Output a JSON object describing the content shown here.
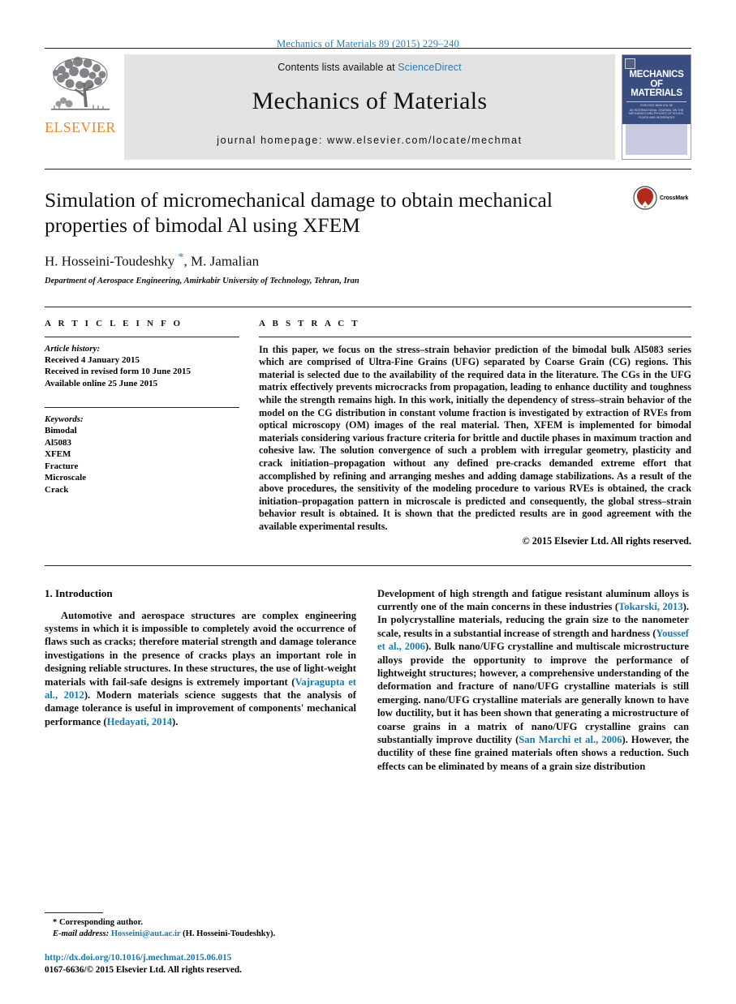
{
  "running_head": "Mechanics of Materials 89 (2015) 229–240",
  "masthead": {
    "publisher_logo_word": "ELSEVIER",
    "contents_prefix": "Contents lists available at ",
    "contents_link": "ScienceDirect",
    "journal_name": "Mechanics of Materials",
    "homepage": "journal homepage: www.elsevier.com/locate/mechmat",
    "cover": {
      "line1": "MECHANICS",
      "line2": "OF",
      "line3": "MATERIALS",
      "issn_line": "ISSN 0167-6636   VOL 89",
      "blurb": "AN INTERNATIONAL JOURNAL ON THE MECHANICS AND PHYSICS OF SOLIDS, FLUIDS AND INTERFACES"
    }
  },
  "article": {
    "title": "Simulation of micromechanical damage to obtain mechanical properties of bimodal Al using XFEM",
    "authors_part1": "H. Hosseini-Toudeshky ",
    "authors_star": "*",
    "authors_part2": ", M. Jamalian",
    "affiliation": "Department of Aerospace Engineering, Amirkabir University of Technology, Tehran, Iran",
    "crossmark_label": "CrossMark"
  },
  "article_info": {
    "heading": "A R T I C L E  I N F O",
    "history_label": "Article history:",
    "history": [
      "Received 4 January 2015",
      "Received in revised form 10 June 2015",
      "Available online 25 June 2015"
    ],
    "keywords_label": "Keywords:",
    "keywords": [
      "Bimodal",
      "Al5083",
      "XFEM",
      "Fracture",
      "Microscale",
      "Crack"
    ]
  },
  "abstract": {
    "heading": "A B S T R A C T",
    "text": "In this paper, we focus on the stress–strain behavior prediction of the bimodal bulk Al5083 series which are comprised of Ultra-Fine Grains (UFG) separated by Coarse Grain (CG) regions. This material is selected due to the availability of the required data in the literature. The CGs in the UFG matrix effectively prevents microcracks from propagation, leading to enhance ductility and toughness while the strength remains high. In this work, initially the dependency of stress–strain behavior of the model on the CG distribution in constant volume fraction is investigated by extraction of RVEs from optical microscopy (OM) images of the real material. Then, XFEM is implemented for bimodal materials considering various fracture criteria for brittle and ductile phases in maximum traction and cohesive law. The solution convergence of such a problem with irregular geometry, plasticity and crack initiation–propagation without any defined pre-cracks demanded extreme effort that accomplished by refining and arranging meshes and adding damage stabilizations. As a result of the above procedures, the sensitivity of the modeling procedure to various RVEs is obtained, the crack initiation–propagation pattern in microscale is predicted and consequently, the global stress–strain behavior result is obtained. It is shown that the predicted results are in good agreement with the available experimental results.",
    "copyright": "© 2015 Elsevier Ltd. All rights reserved."
  },
  "introduction": {
    "section_title": "1. Introduction",
    "left_p1_a": "Automotive and aerospace structures are complex engineering systems in which it is impossible to completely avoid the occurrence of flaws such as cracks; therefore material strength and damage tolerance investigations in the presence of cracks plays an important role in designing reliable structures. In these structures, the use of light-weight materials with fail-safe designs is extremely important (",
    "left_ref1": "Vajragupta et al., 2012",
    "left_p1_b": "). Modern materials science suggests that the analysis of damage tolerance is useful in improvement of components' mechanical performance (",
    "left_ref2": "Hedayati, 2014",
    "left_p1_c": ").",
    "right_p1_a": "Development of high strength and fatigue resistant aluminum alloys is currently one of the main concerns in these industries (",
    "right_ref1": "Tokarski, 2013",
    "right_p1_b": "). In polycrystalline materials, reducing the grain size to the nanometer scale, results in a substantial increase of strength and hardness (",
    "right_ref2": "Youssef et al., 2006",
    "right_p1_c": "). Bulk nano/UFG crystalline and multiscale microstructure alloys provide the opportunity to improve the performance of lightweight structures; however, a comprehensive understanding of the deformation and fracture of nano/UFG crystalline materials is still emerging. nano/UFG crystalline materials are generally known to have low ductility, but it has been shown that generating a microstructure of coarse grains in a matrix of nano/UFG crystalline grains can substantially improve ductility (",
    "right_ref3": "San Marchi et al., 2006",
    "right_p1_d": "). However, the ductility of these fine grained materials often shows a reduction. Such effects can be eliminated by means of a grain size distribution"
  },
  "footer": {
    "corresponding_marker": "*",
    "corresponding_text": "Corresponding author.",
    "email_label": "E-mail address:",
    "email": "Hosseini@aut.ac.ir",
    "email_suffix": "(H. Hosseini-Toudeshky).",
    "doi": "http://dx.doi.org/10.1016/j.mechmat.2015.06.015",
    "issn_copyright": "0167-6636/© 2015 Elsevier Ltd. All rights reserved."
  },
  "colors": {
    "link_blue": "#1a7aad",
    "running_head_blue": "#2a7ab0",
    "elsevier_orange": "#f08622",
    "cover_blue": "#3a4d80",
    "masthead_gray": "#e3e3e3"
  }
}
